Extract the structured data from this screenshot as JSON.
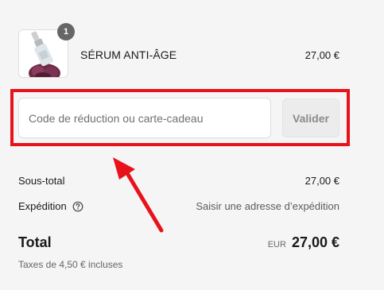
{
  "product": {
    "quantity": "1",
    "name": "SÉRUM ANTI-ÂGE",
    "price": "27,00 €",
    "thumbnail_icon": "serum-bottle-icon"
  },
  "discount": {
    "placeholder": "Code de réduction ou carte-cadeau",
    "value": "",
    "apply_label": "Valider"
  },
  "summary": {
    "subtotal_label": "Sous-total",
    "subtotal_value": "27,00 €",
    "shipping_label": "Expédition",
    "shipping_value": "Saisir une adresse d’expédition",
    "total_label": "Total",
    "currency": "EUR",
    "total_value": "27,00 €",
    "taxes_note": "Taxes de 4,50 € incluses"
  },
  "annotation": {
    "highlight_color": "#e8121b"
  }
}
